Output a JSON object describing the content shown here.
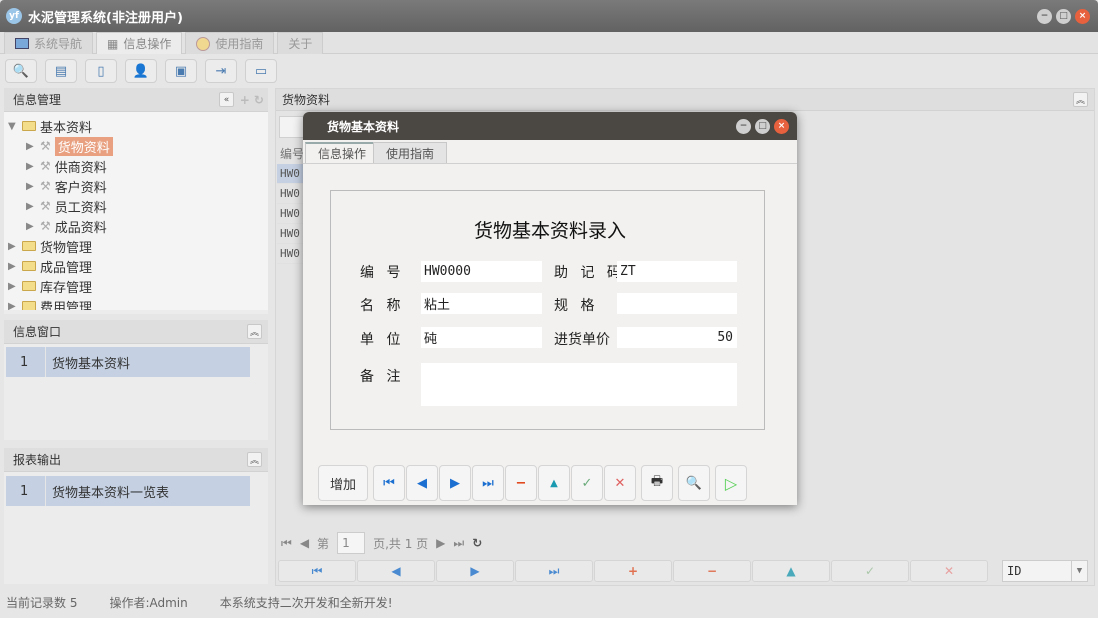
{
  "window": {
    "title": "水泥管理系统(非注册用户)"
  },
  "tabs": [
    {
      "label": "系统导航"
    },
    {
      "label": "信息操作"
    },
    {
      "label": "使用指南"
    },
    {
      "label": "关于"
    }
  ],
  "left": {
    "info_mgmt": {
      "title": "信息管理",
      "tree": [
        {
          "label": "基本资料",
          "children": [
            "货物资料",
            "供商资料",
            "客户资料",
            "员工资料",
            "成品资料"
          ]
        },
        {
          "label": "货物管理"
        },
        {
          "label": "成品管理"
        },
        {
          "label": "库存管理"
        },
        {
          "label": "费用管理"
        }
      ]
    },
    "info_window": {
      "title": "信息窗口",
      "rows": [
        {
          "n": "1",
          "label": "货物基本资料"
        }
      ]
    },
    "report": {
      "title": "报表输出",
      "rows": [
        {
          "n": "1",
          "label": "货物基本资料一览表"
        }
      ]
    }
  },
  "right": {
    "title": "货物资料",
    "grid_header": "编号",
    "rows": [
      "HW0",
      "HW0",
      "HW0",
      "HW0",
      "HW0"
    ],
    "pager": {
      "page_prefix": "第",
      "page": "1",
      "page_suffix": "页,共 1 页"
    },
    "select_value": "ID"
  },
  "dialog": {
    "title": "货物基本资料",
    "tabs": [
      "信息操作",
      "使用指南"
    ],
    "heading": "货物基本资料录入",
    "fields": {
      "code_label": "编 号",
      "code": "HW0000",
      "mnemonic_label": "助 记 码",
      "mnemonic": "ZT",
      "name_label": "名 称",
      "name": "粘土",
      "spec_label": "规 格",
      "spec": "",
      "unit_label": "单 位",
      "unit": "砘",
      "price_label": "进货单价",
      "price": "50",
      "note_label": "备 注",
      "note": ""
    },
    "add_label": "增加"
  },
  "status": {
    "records": "当前记录数 5",
    "operator": "操作者:Admin",
    "message": "本系统支持二次开发和全新开发!"
  }
}
